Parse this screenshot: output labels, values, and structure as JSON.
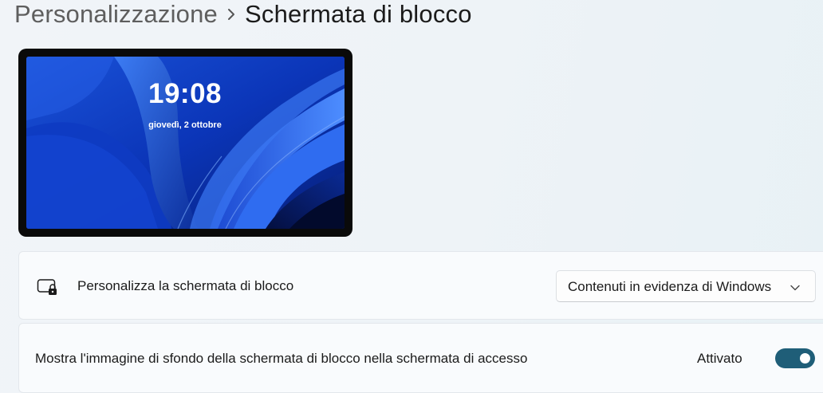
{
  "breadcrumb": {
    "parent": "Personalizzazione",
    "current": "Schermata di blocco",
    "separator_icon": "chevron-right-icon"
  },
  "preview": {
    "time": "19:08",
    "date": "giovedì, 2 ottobre",
    "wallpaper": "windows-11-bloom-blue"
  },
  "lock_screen_setting": {
    "icon": "lock-screen-icon",
    "label": "Personalizza la schermata di blocco",
    "dropdown_value": "Contenuti in evidenza di Windows",
    "dropdown_icon": "chevron-down-icon"
  },
  "signin_background_setting": {
    "label": "Mostra l'immagine di sfondo della schermata di blocco nella schermata di accesso",
    "state_label": "Attivato",
    "enabled": true
  },
  "colors": {
    "accent": "#1f5e78",
    "wallpaper_blue": "#0b2fa8"
  }
}
